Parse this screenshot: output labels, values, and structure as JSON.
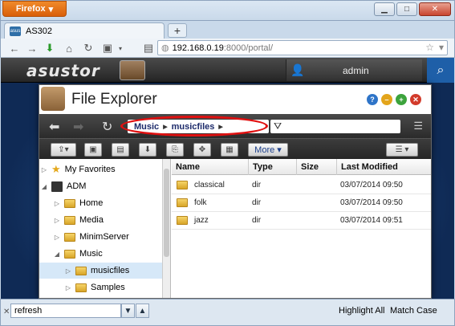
{
  "browser": {
    "app_button": "Firefox",
    "tab_title": "AS302",
    "tab_favicon_text": "asus",
    "new_tab": "+",
    "url_host": "192.168.0.19",
    "url_path": ":8000/portal/"
  },
  "adm": {
    "logo": "asustor",
    "username": "admin"
  },
  "file_explorer": {
    "title": "File Explorer",
    "breadcrumb": [
      "Music",
      "musicfiles"
    ],
    "more_label": "More",
    "tree": [
      {
        "label": "My Favorites",
        "icon": "star-icon",
        "level": 0,
        "expanded": false
      },
      {
        "label": "ADM",
        "icon": "adm-icon",
        "level": 0,
        "expanded": true
      },
      {
        "label": "Home",
        "icon": "folder-icon",
        "level": 1,
        "expanded": false
      },
      {
        "label": "Media",
        "icon": "folder-icon",
        "level": 1,
        "expanded": false
      },
      {
        "label": "MinimServer",
        "icon": "folder-icon",
        "level": 1,
        "expanded": false
      },
      {
        "label": "Music",
        "icon": "folder-icon",
        "level": 1,
        "expanded": true
      },
      {
        "label": "musicfiles",
        "icon": "folder-icon",
        "level": 2,
        "expanded": false,
        "selected": true
      },
      {
        "label": "Samples",
        "icon": "folder-icon",
        "level": 2,
        "expanded": false
      }
    ],
    "columns": [
      "Name",
      "Type",
      "Size",
      "Last Modified"
    ],
    "rows": [
      {
        "name": "classical",
        "type": "dir",
        "size": "",
        "modified": "03/07/2014 09:50"
      },
      {
        "name": "folk",
        "type": "dir",
        "size": "",
        "modified": "03/07/2014 09:50"
      },
      {
        "name": "jazz",
        "type": "dir",
        "size": "",
        "modified": "03/07/2014 09:51"
      }
    ]
  },
  "findbar": {
    "query": "refresh",
    "highlight_all": "Highlight All",
    "match_case": "Match Case"
  },
  "colors": {
    "accent_red": "#e01010",
    "firefox_orange": "#e8731a",
    "breadcrumb_text": "#1c2a6a"
  }
}
